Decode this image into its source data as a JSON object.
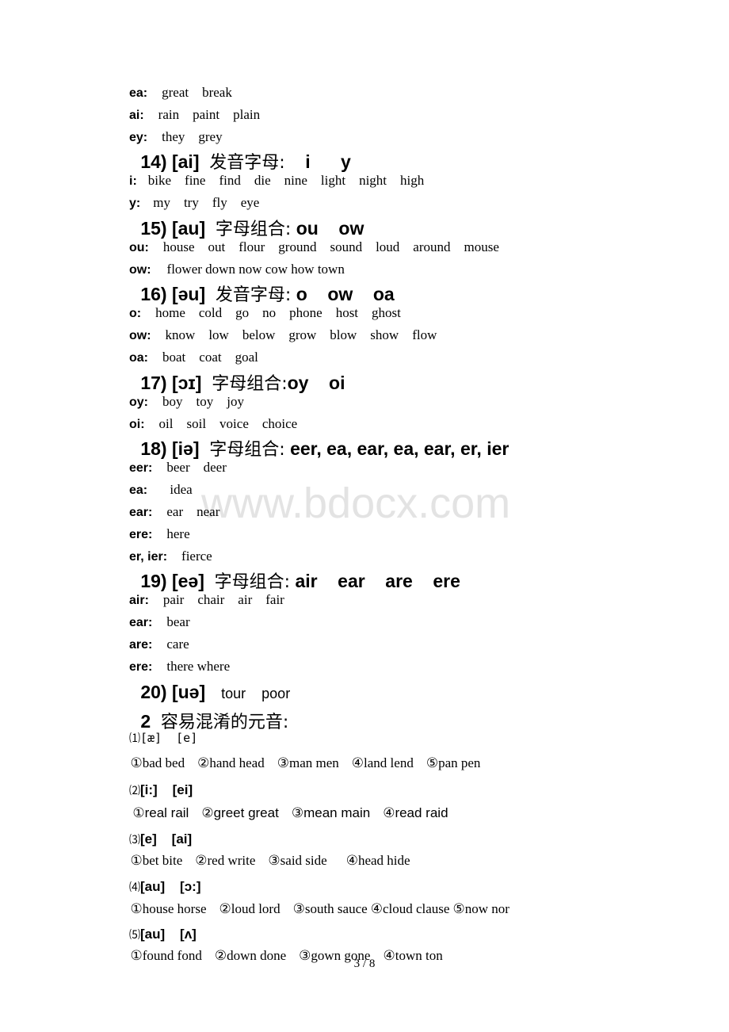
{
  "watermark": "www.bdocx.com",
  "lines_top": [
    {
      "label": "ea:",
      "words": "great    break"
    },
    {
      "label": "ai:",
      "words": "rain    paint    plain"
    },
    {
      "label": "ey:",
      "words": "they    grey"
    }
  ],
  "sections": [
    {
      "heading_prefix": "14) [ai]",
      "heading_cn": "发音字母:",
      "heading_letters": "    i      y",
      "rows": [
        {
          "label": "i:",
          "words": "bike    fine    find    die    nine    light    night    high"
        },
        {
          "label": "y:",
          "words": "my    try    fly    eye"
        }
      ]
    },
    {
      "heading_prefix": "15) [au]",
      "heading_cn": "字母组合:",
      "heading_letters": " ou    ow",
      "rows": [
        {
          "label": "ou:",
          "words": "house    out    flour    ground    sound    loud    around    mouse"
        },
        {
          "label": "ow:",
          "words": "flower down now cow how town"
        }
      ]
    },
    {
      "heading_prefix": "16) [əu]",
      "heading_cn": "发音字母:",
      "heading_letters": " o    ow    oa",
      "rows": [
        {
          "label": "o:",
          "words": "home    cold    go    no    phone    host    ghost"
        },
        {
          "label": "ow:",
          "words": "know    low    below    grow    blow    show    flow"
        },
        {
          "label": "oa:",
          "words": "boat    coat    goal"
        }
      ]
    },
    {
      "heading_prefix": "17) [ɔɪ]",
      "heading_cn": "字母组合:",
      "heading_letters": "oy    oi",
      "rows": [
        {
          "label": "oy:",
          "words": "boy    toy    joy"
        },
        {
          "label": "oi:",
          "words": "oil    soil    voice    choice"
        }
      ]
    },
    {
      "heading_prefix": "18) [iə]",
      "heading_cn": "字母组合:",
      "heading_letters": " eer, ea, ear, ea, ear, er, ier",
      "rows": [
        {
          "label": "eer:",
          "words": "beer    deer"
        },
        {
          "label": "ea:",
          "words": " idea"
        },
        {
          "label": "ear:",
          "words": "ear    near"
        },
        {
          "label": "ere:",
          "words": "here"
        },
        {
          "label": "er, ier:",
          "words": "fierce"
        }
      ]
    },
    {
      "heading_prefix": "19) [eə]",
      "heading_cn": "字母组合:",
      "heading_letters": " air    ear    are    ere",
      "rows": [
        {
          "label": "air:",
          "words": "pair    chair    air    fair"
        },
        {
          "label": "ear:",
          "words": "bear"
        },
        {
          "label": "are:",
          "words": "care"
        },
        {
          "label": "ere:",
          "words": "there where"
        }
      ]
    },
    {
      "heading_prefix": "20) [uə]",
      "trailing_words": "tour    poor"
    }
  ],
  "part2": {
    "heading_num": "2",
    "heading_cn": "容易混淆的元音:",
    "groups": [
      {
        "marker": "⑴",
        "phonetics": "[æ]  [e]",
        "style": "serif",
        "pairs": [
          {
            "n": "①",
            "text": "bad bed"
          },
          {
            "n": "②",
            "text": "hand head"
          },
          {
            "n": "③",
            "text": "man men"
          },
          {
            "n": "④",
            "text": "land lend"
          },
          {
            "n": "⑤",
            "text": "pan pen"
          }
        ]
      },
      {
        "marker": "⑵",
        "phonetics": "[i:]    [ei]",
        "style": "sans",
        "pairs": [
          {
            "n": "①",
            "text": "real rail"
          },
          {
            "n": "②",
            "text": "greet great"
          },
          {
            "n": "③",
            "text": "mean main"
          },
          {
            "n": "④",
            "text": "read raid"
          }
        ]
      },
      {
        "marker": "⑶",
        "phonetics": "[e]    [ai]",
        "style": "serif",
        "pairs": [
          {
            "n": "①",
            "text": "bet bite"
          },
          {
            "n": "②",
            "text": "red write"
          },
          {
            "n": "③",
            "text": "said side"
          },
          {
            "n": "④",
            "text": "head hide"
          }
        ]
      },
      {
        "marker": "⑷",
        "phonetics": "[au]    [ɔ:]",
        "style": "serif",
        "pairs": [
          {
            "n": "①",
            "text": "house horse"
          },
          {
            "n": "②",
            "text": "loud lord"
          },
          {
            "n": "③",
            "text": "south sauce"
          },
          {
            "n": "④",
            "text": "cloud clause"
          },
          {
            "n": "⑤",
            "text": "now nor"
          }
        ]
      },
      {
        "marker": "⑸",
        "phonetics": "[au]    [ʌ]",
        "style": "serif",
        "pairs": [
          {
            "n": "①",
            "text": "found fond"
          },
          {
            "n": "②",
            "text": "down done"
          },
          {
            "n": "③",
            "text": "gown gone"
          },
          {
            "n": "④",
            "text": "town ton"
          }
        ]
      }
    ]
  },
  "footer": {
    "page_indicator": "3 / 8"
  }
}
